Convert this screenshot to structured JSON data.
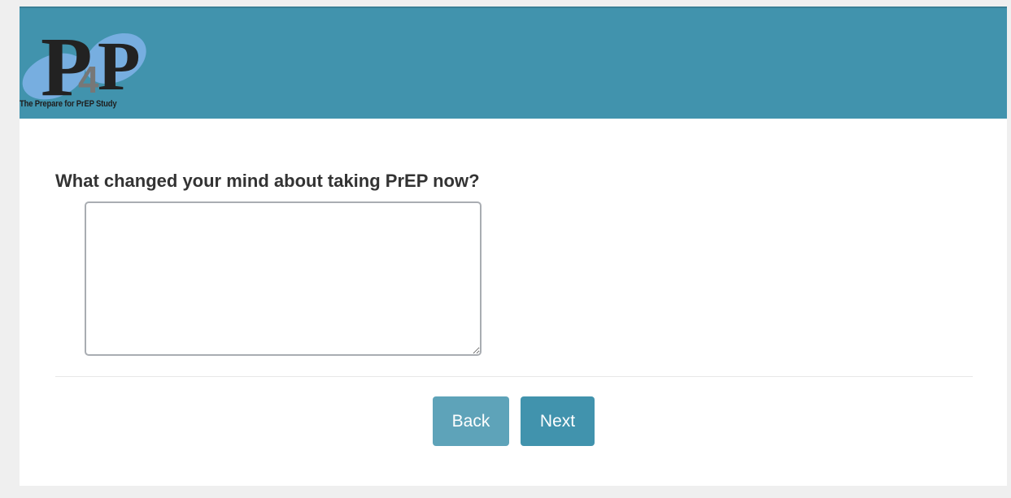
{
  "header": {
    "logo": {
      "letters": [
        "P",
        "4",
        "P"
      ],
      "caption": "The Prepare for PrEP Study"
    }
  },
  "question": {
    "text": "What changed your mind about taking PrEP now?",
    "answer_value": "",
    "answer_placeholder": ""
  },
  "nav": {
    "back_label": "Back",
    "next_label": "Next"
  },
  "colors": {
    "header_bg": "#4193ad",
    "next_button": "#4193ad",
    "back_button": "#5ea3b9",
    "logo_blob": "#77aee0",
    "logo_letter": "#222222",
    "logo_four": "#777777",
    "page_bg": "#efefef"
  }
}
